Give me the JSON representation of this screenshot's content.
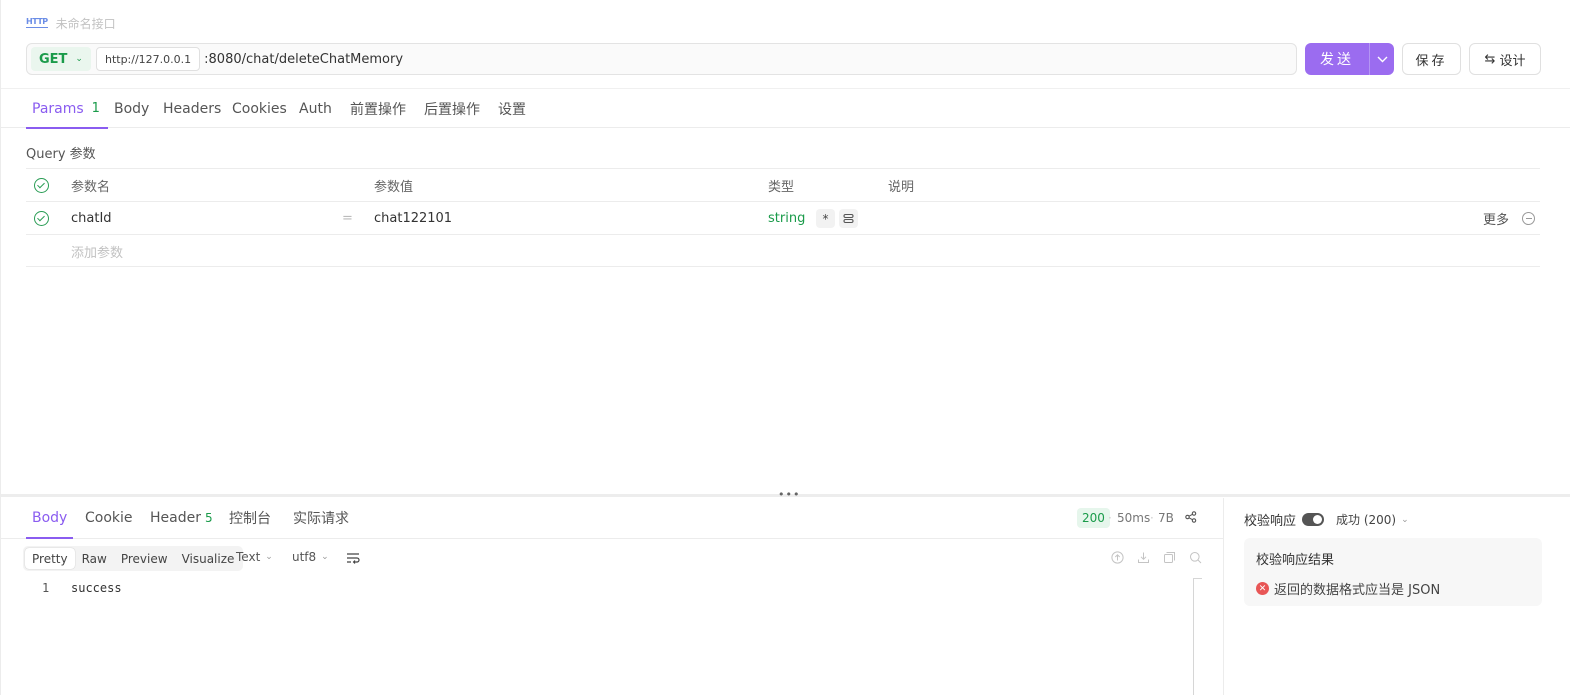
{
  "doc": {
    "badge": "HTTP",
    "title": "未命名接口"
  },
  "request": {
    "method": "GET",
    "host": "http://127.0.0.1",
    "path": ":8080/chat/deleteChatMemory"
  },
  "actions": {
    "send": "发送",
    "save": "保存",
    "design": "设计"
  },
  "tabs": [
    {
      "label": "Params",
      "count": "1"
    },
    {
      "label": "Body"
    },
    {
      "label": "Headers"
    },
    {
      "label": "Cookies"
    },
    {
      "label": "Auth"
    },
    {
      "label": "前置操作"
    },
    {
      "label": "后置操作"
    },
    {
      "label": "设置"
    }
  ],
  "query": {
    "label": "Query 参数",
    "columns": {
      "name": "参数名",
      "value": "参数值",
      "type": "类型",
      "desc": "说明"
    },
    "rows": [
      {
        "name": "chatId",
        "eq": "=",
        "value": "chat122101",
        "type": "string",
        "required": "*",
        "more": "更多"
      }
    ],
    "add_placeholder": "添加参数"
  },
  "response": {
    "tabs": [
      {
        "label": "Body"
      },
      {
        "label": "Cookie"
      },
      {
        "label": "Header",
        "count": "5"
      },
      {
        "label": "控制台"
      },
      {
        "label": "实际请求"
      }
    ],
    "status": "200",
    "time": "50ms",
    "size": "7B",
    "views": [
      "Pretty",
      "Raw",
      "Preview",
      "Visualize"
    ],
    "format": "Text",
    "encoding": "utf8",
    "lines": [
      {
        "no": "1",
        "text": "success"
      }
    ]
  },
  "validation": {
    "label": "校验响应",
    "status": "成功 (200)",
    "result_title": "校验响应结果",
    "error": "返回的数据格式应当是 JSON",
    "error_icon": "x-circle-icon"
  },
  "colors": {
    "accent": "#8a5cf0",
    "send": "#9b6cf0",
    "success": "#1a9b4a",
    "error": "#e85656"
  }
}
